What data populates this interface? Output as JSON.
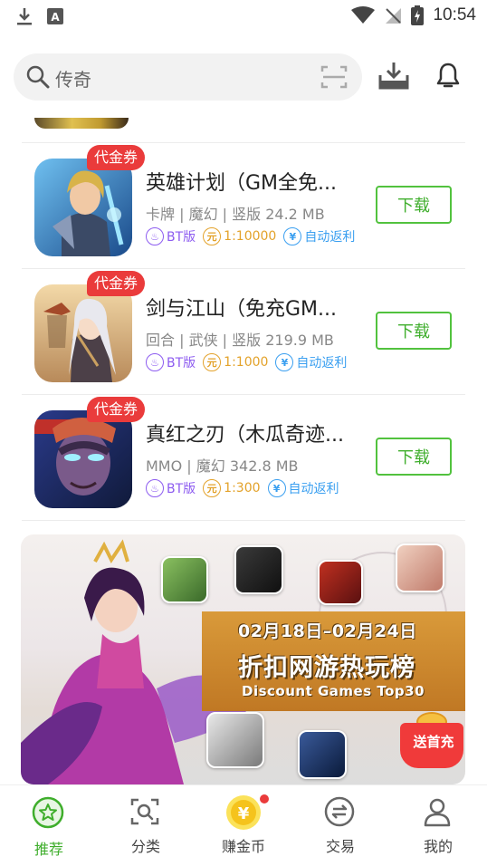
{
  "status_bar": {
    "time": "10:54"
  },
  "search": {
    "placeholder": "传奇"
  },
  "games": [
    {
      "coupon": "代金券",
      "title": "英雄计划（GM全免...",
      "meta": "卡牌 | 魔幻 | 竖版 24.2 MB",
      "tags": {
        "bt": "BT版",
        "ratio": "1:10000",
        "rebate": "自动返利"
      },
      "download": "下载"
    },
    {
      "coupon": "代金券",
      "title": "剑与江山（免充GM...",
      "meta": "回合 | 武侠 | 竖版 219.9 MB",
      "tags": {
        "bt": "BT版",
        "ratio": "1:1000",
        "rebate": "自动返利"
      },
      "download": "下载"
    },
    {
      "coupon": "代金券",
      "title": "真红之刃（木瓜奇迹...",
      "meta": "MMO | 魔幻 342.8 MB",
      "tags": {
        "bt": "BT版",
        "ratio": "1:300",
        "rebate": "自动返利"
      },
      "download": "下载"
    }
  ],
  "banner": {
    "date_range": "02月18日–02月24日",
    "title": "折扣网游热玩榜",
    "subtitle": "Discount Games Top30",
    "promo": "送首充"
  },
  "nav": [
    {
      "label": "推荐",
      "active": true
    },
    {
      "label": "分类",
      "active": false
    },
    {
      "label": "赚金币",
      "active": false
    },
    {
      "label": "交易",
      "active": false
    },
    {
      "label": "我的",
      "active": false
    }
  ],
  "colors": {
    "accent_green": "#3fae2c",
    "coupon_red": "#ea3b3b",
    "bt_purple": "#8d5cf0",
    "ratio_orange": "#e3a22a",
    "rebate_blue": "#3a9ff0"
  }
}
